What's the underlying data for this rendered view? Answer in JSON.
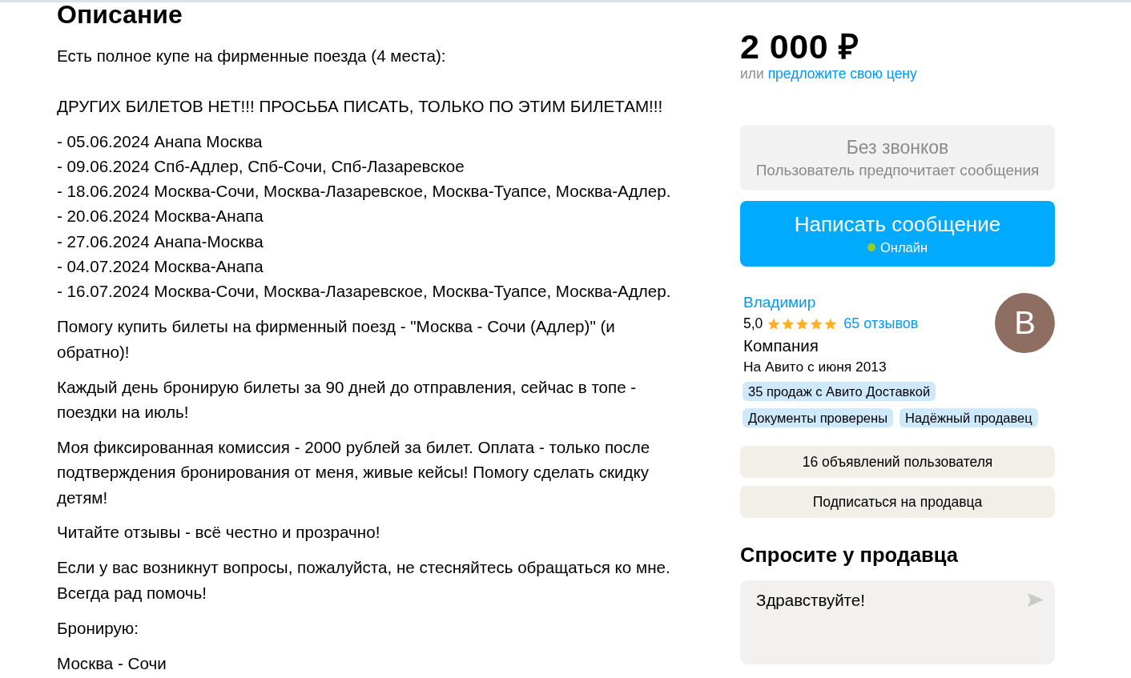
{
  "description": {
    "title": "Описание",
    "blocks": [
      {
        "kind": "paragraph",
        "text": "Есть полное купе на фирменные поезда (4 места):\n\nДРУГИХ БИЛЕТОВ НЕТ!!! ПРОСЬБА ПИСАТЬ, ТОЛЬКО ПО ЭТИМ БИЛЕТАМ!!!"
      },
      {
        "kind": "lines",
        "lines": [
          "- 05.06.2024 Анапа Москва",
          "- 09.06.2024 Спб-Адлер, Спб-Сочи, Спб-Лазаревское",
          "- 18.06.2024 Москва-Сочи, Москва-Лазаревское, Москва-Туапсе, Москва-Адлер.",
          "- 20.06.2024 Москва-Анапа",
          "- 27.06.2024 Анапа-Москва",
          "- 04.07.2024 Москва-Анапа",
          "- 16.07.2024 Москва-Сочи, Москва-Лазаревское, Москва-Туапсе, Москва-Адлер."
        ]
      },
      {
        "kind": "paragraph",
        "text": "Помогу купить билеты на фирменный поезд - \"Москва - Сочи (Адлер)\" (и обратно)!"
      },
      {
        "kind": "paragraph",
        "text": "Каждый день бронирую билеты за 90 дней до отправления, сейчас в топе - поездки на июль!"
      },
      {
        "kind": "paragraph",
        "text": "Моя фиксированная комиссия - 2000 рублей за билет. Оплата - только после подтверждения бронирования от меня, живые кейсы! Помогу сделать скидку детям!"
      },
      {
        "kind": "paragraph",
        "text": "Читайте отзывы - всё честно и прозрачно!"
      },
      {
        "kind": "paragraph",
        "text": "Если у вас возникнут вопросы, пожалуйста, не стесняйтесь обращаться ко мне. Всегда рад помочь!"
      },
      {
        "kind": "paragraph",
        "text": "Бронирую:"
      },
      {
        "kind": "paragraph",
        "text": "Москва - Сочи"
      }
    ]
  },
  "price": {
    "value": "2 000 ₽",
    "offer_prefix": "или",
    "offer_link": "предложите свою цену"
  },
  "call_notice": {
    "title": "Без звонков",
    "subtitle": "Пользователь предпочитает сообщения"
  },
  "message_button": {
    "label": "Написать сообщение",
    "status": "Онлайн",
    "online": true
  },
  "seller": {
    "name": "Владимир",
    "rating": "5,0",
    "stars": 5,
    "reviews": "65 отзывов",
    "type": "Компания",
    "since": "На Авито с июня 2013",
    "avatar_letter": "В",
    "badges": [
      "35 продаж с Авито Доставкой",
      "Документы проверены",
      "Надёжный продавец"
    ]
  },
  "seller_actions": [
    "16 объявлений пользователя",
    "Подписаться на продавца"
  ],
  "ask": {
    "title": "Спросите у продавца",
    "message": "Здравствуйте!"
  }
}
